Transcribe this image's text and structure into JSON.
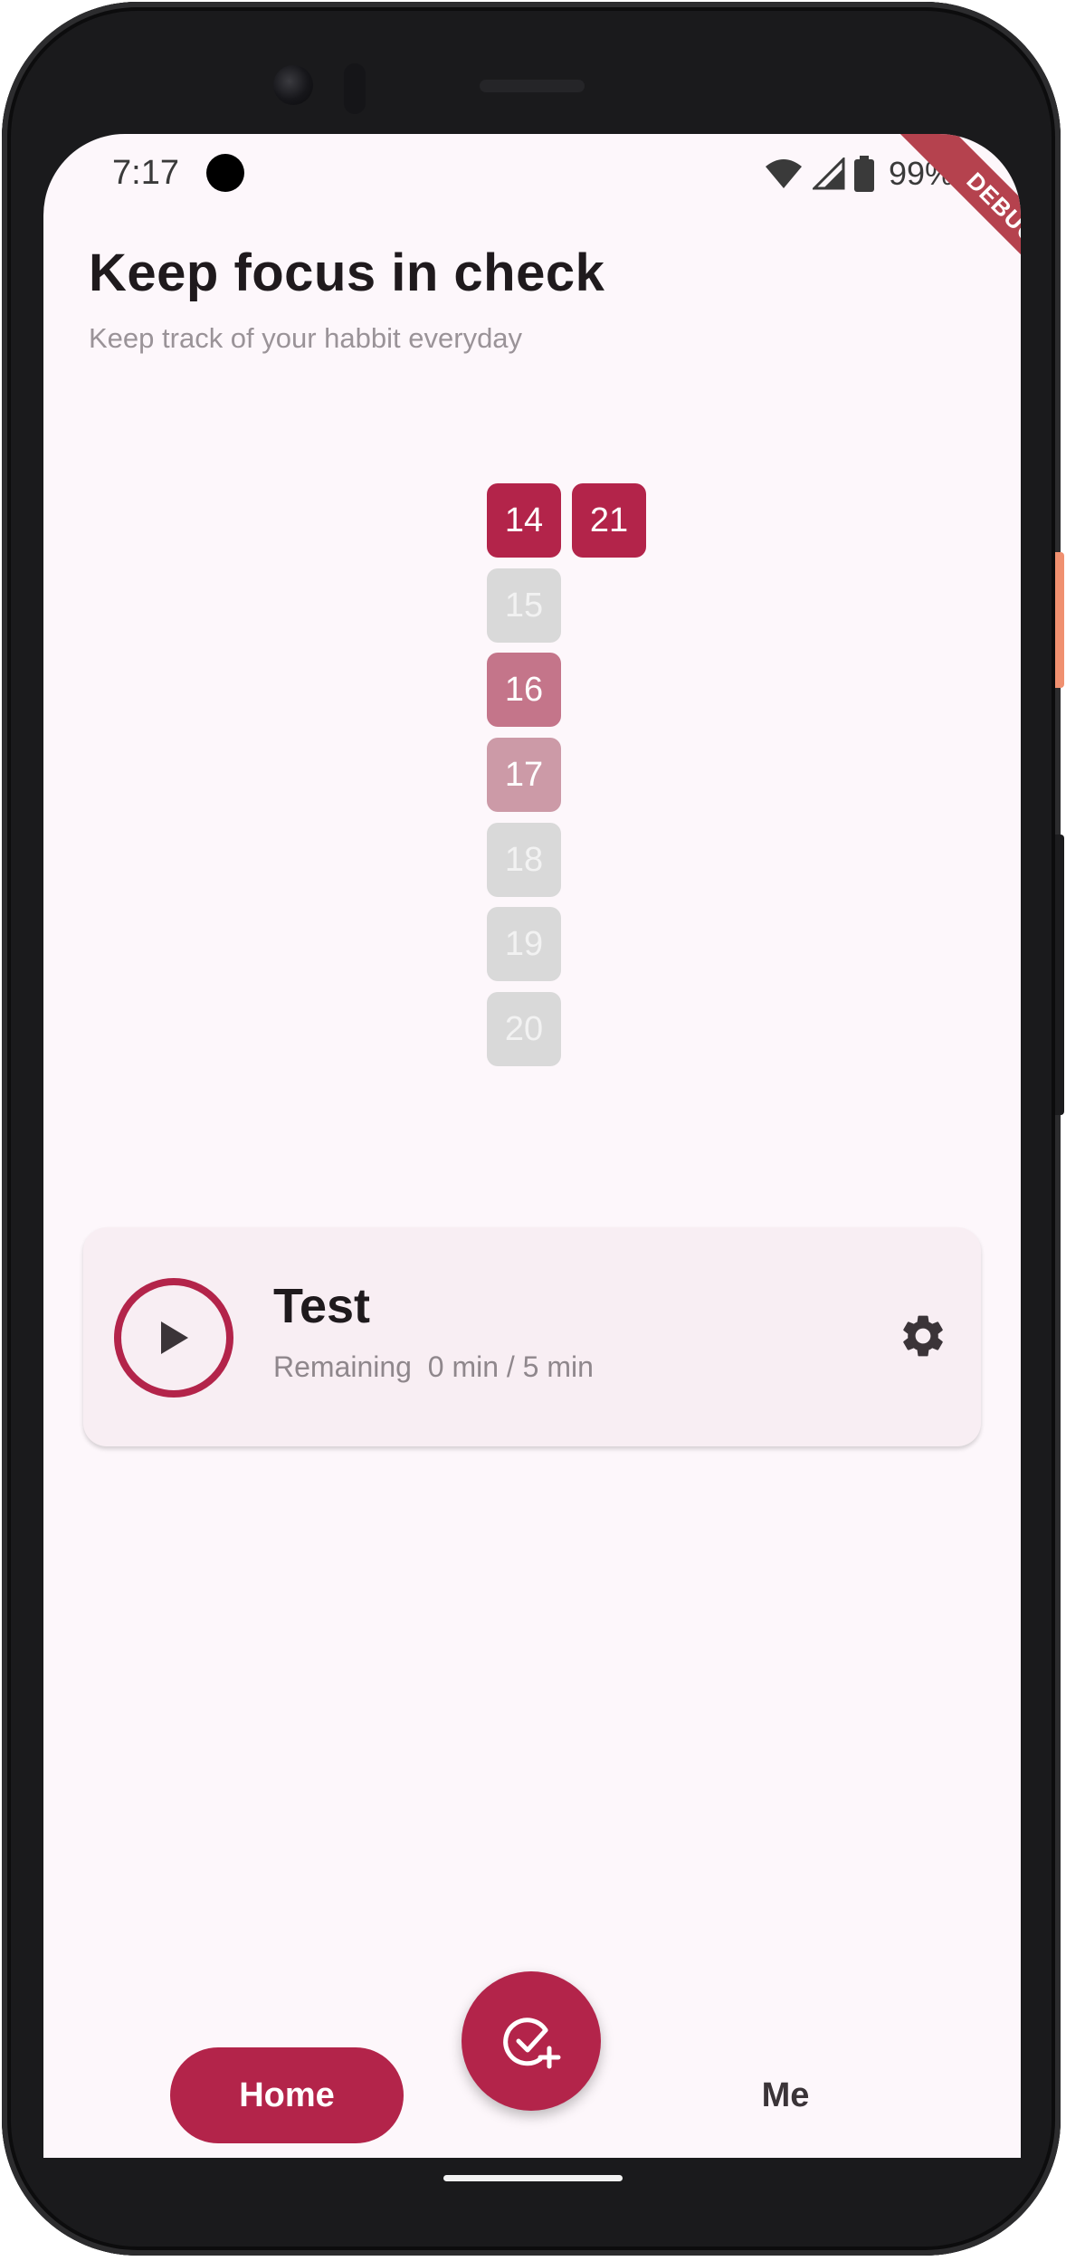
{
  "status_bar": {
    "time": "7:17",
    "battery_text": "99%",
    "icons": [
      "wifi-icon",
      "cell-signal-icon",
      "battery-icon"
    ]
  },
  "debug_banner": "DEBUG",
  "header": {
    "title": "Keep focus in check",
    "subtitle": "Keep track of your habbit everyday"
  },
  "calendar": {
    "days": [
      {
        "label": "14",
        "level": 1.0
      },
      {
        "label": "15",
        "level": 0.0
      },
      {
        "label": "16",
        "level": 0.55
      },
      {
        "label": "17",
        "level": 0.35
      },
      {
        "label": "18",
        "level": 0.0
      },
      {
        "label": "19",
        "level": 0.0
      },
      {
        "label": "20",
        "level": 0.0
      },
      {
        "label": "21",
        "level": 1.0
      }
    ]
  },
  "habit_card": {
    "name": "Test",
    "remaining": "Remaining  0 min / 5 min",
    "play_icon": "play-icon",
    "settings_icon": "gear-icon"
  },
  "bottom_nav": {
    "home_label": "Home",
    "me_label": "Me",
    "fab_icon": "add-task-icon"
  },
  "colors": {
    "accent": "#b3244a",
    "background": "#fdf7fb",
    "card": "#f8eef3",
    "empty_day": "#d9d9d9"
  }
}
